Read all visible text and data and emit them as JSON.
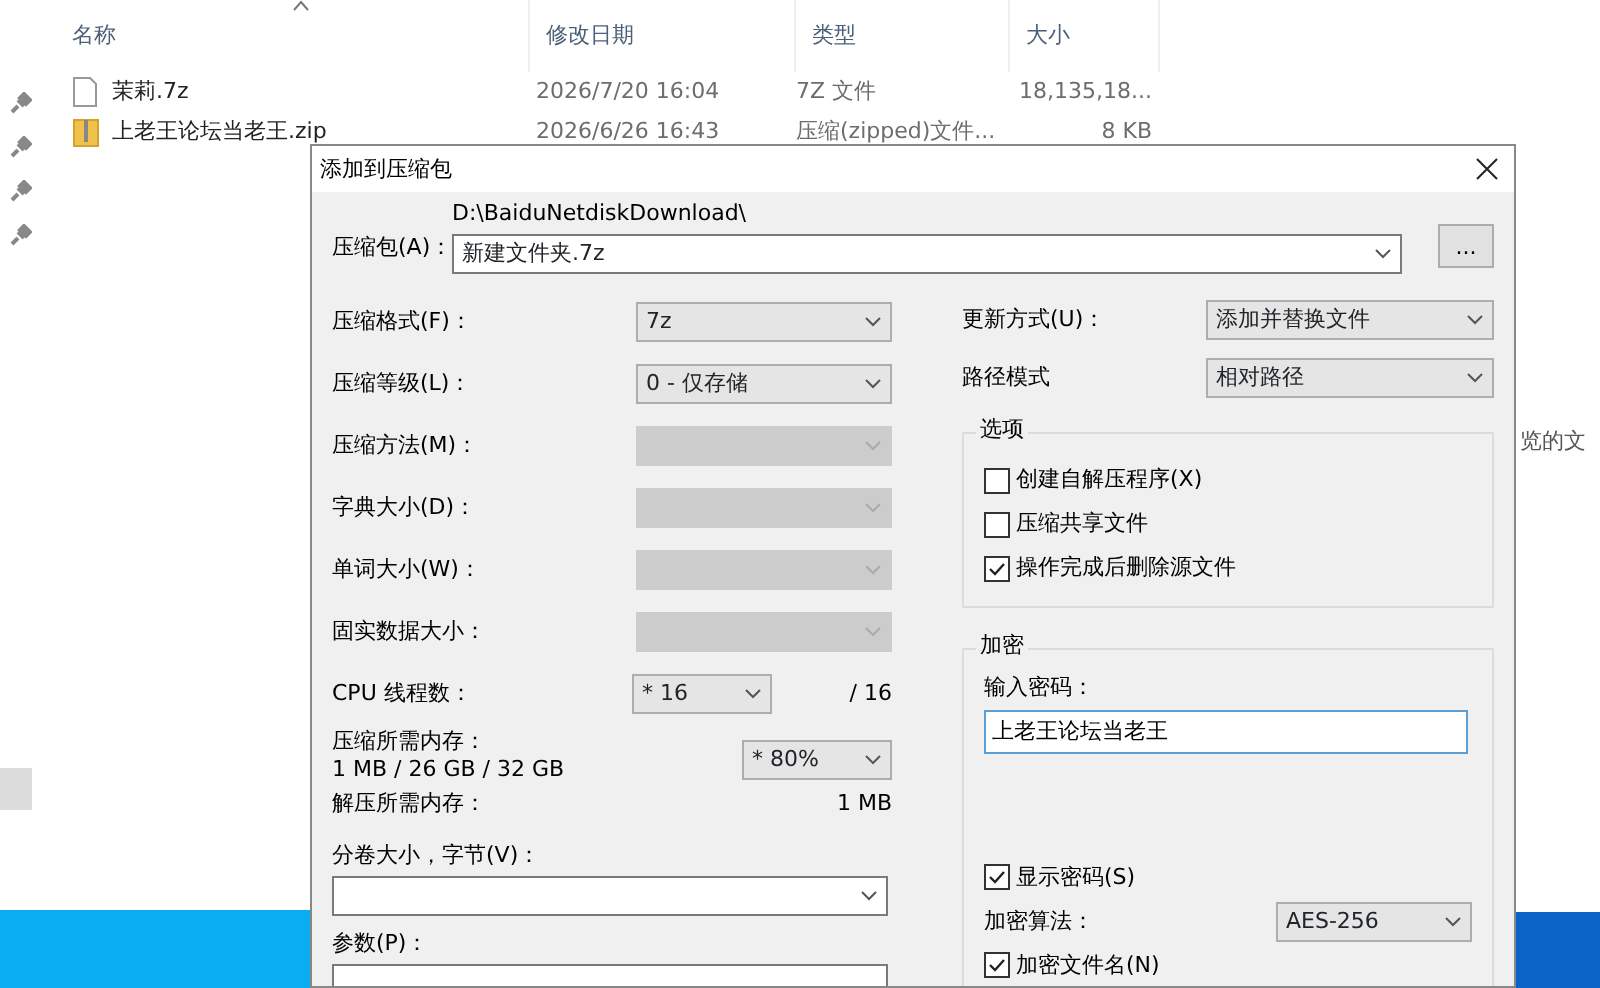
{
  "explorer": {
    "columns": [
      {
        "label": "名称",
        "sorted": true
      },
      {
        "label": "修改日期",
        "sorted": false
      },
      {
        "label": "类型",
        "sorted": false
      },
      {
        "label": "大小",
        "sorted": false
      }
    ],
    "files": [
      {
        "kind": "document",
        "name": "茉莉.7z",
        "modified": "2026/7/20 16:04",
        "type": "7Z 文件",
        "size": "18,135,18..."
      },
      {
        "kind": "zipfolder",
        "name": "上老王论坛当老王.zip",
        "modified": "2026/6/26 16:43",
        "type": "压缩(zipped)文件...",
        "size": "8 KB"
      }
    ],
    "side_text": "览的文"
  },
  "dialog": {
    "title": "添加到压缩包",
    "archive": {
      "label": "压缩包(A)：",
      "path": "D:\\BaiduNetdiskDownload\\",
      "value": "新建文件夹.7z",
      "browse": "..."
    },
    "left": [
      {
        "kind": "select",
        "label": "压缩格式(F)：",
        "value": "7z",
        "disabled": false
      },
      {
        "kind": "select",
        "label": "压缩等级(L)：",
        "value": "0 - 仅存储",
        "disabled": false
      },
      {
        "kind": "select",
        "label": "压缩方法(M)：",
        "disabled": true
      },
      {
        "kind": "select",
        "label": "字典大小(D)：",
        "disabled": true
      },
      {
        "kind": "select",
        "label": "单词大小(W)：",
        "disabled": true
      },
      {
        "kind": "select",
        "label": "固实数据大小：",
        "disabled": true
      },
      {
        "kind": "small-select",
        "label": "CPU 线程数：",
        "value": "* 16",
        "note": "/ 16"
      },
      {
        "kind": "memory",
        "label": "压缩所需内存：",
        "sublabel": "1 MB / 26 GB / 32 GB",
        "value": "* 80%"
      },
      {
        "kind": "info",
        "label": "解压所需内存：",
        "note": "1 MB"
      },
      {
        "kind": "combo-below",
        "label": "分卷大小，字节(V)："
      },
      {
        "kind": "field-below",
        "label": "参数(P)："
      }
    ],
    "update_mode": {
      "label": "更新方式(U)：",
      "value": "添加并替换文件"
    },
    "path_mode": {
      "label": "路径模式",
      "value": "相对路径"
    },
    "options": {
      "title": "选项",
      "items": [
        {
          "label": "创建自解压程序(X)",
          "checked": false
        },
        {
          "label": "压缩共享文件",
          "checked": false
        },
        {
          "label": "操作完成后删除源文件",
          "checked": true
        }
      ]
    },
    "encryption": {
      "title": "加密",
      "password_label": "输入密码：",
      "password": "上老王论坛当老王",
      "show_password": {
        "label": "显示密码(S)",
        "checked": true
      },
      "method_label": "加密算法：",
      "method": "AES-256",
      "encrypt_names": {
        "label": "加密文件名(N)",
        "checked": true
      }
    }
  }
}
